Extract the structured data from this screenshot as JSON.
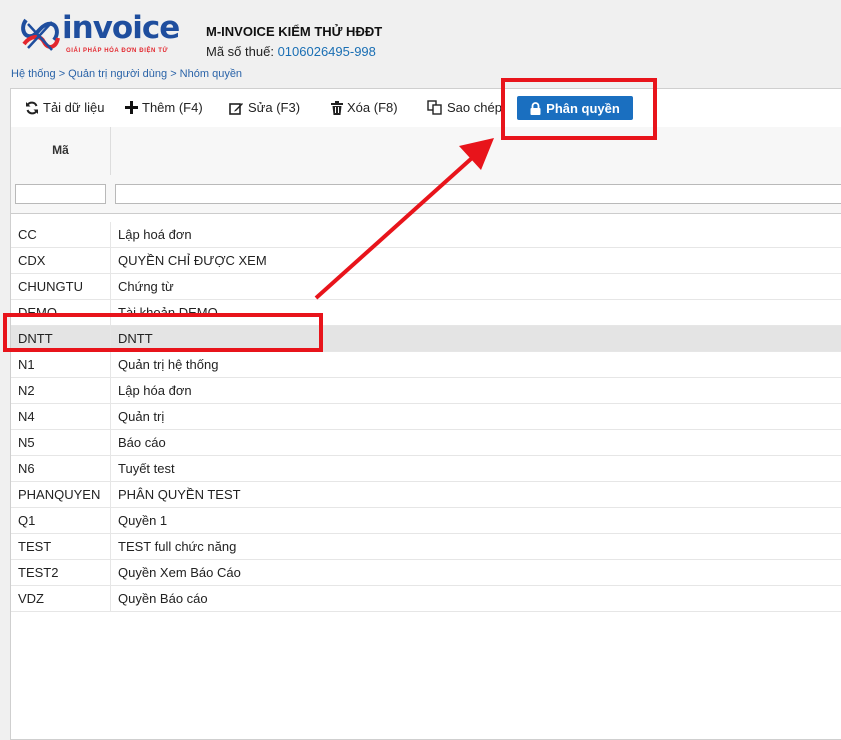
{
  "brand": {
    "logo_word": "invoice",
    "tagline": "GIẢI PHÁP HÓA ĐƠN ĐIỆN TỬ",
    "primary_color": "#1f4e9e",
    "accent_color": "#e3262d"
  },
  "header": {
    "company": "M-INVOICE KIỂM THỬ HĐĐT",
    "tax_label": "Mã số thuế:",
    "tax_value": "0106026495-998"
  },
  "breadcrumb": "Hệ thống > Quản trị người dùng > Nhóm quyền",
  "toolbar": {
    "reload": "Tải dữ liệu",
    "add": "Thêm (F4)",
    "edit": "Sửa (F3)",
    "delete": "Xóa (F8)",
    "copy": "Sao chép",
    "permission": "Phân quyền",
    "permission_color": "#1a6fc0"
  },
  "grid": {
    "col_code": "Mã",
    "rows": [
      {
        "code": "CC",
        "name": "Lập hoá đơn"
      },
      {
        "code": "CDX",
        "name": "QUYỀN CHỈ ĐƯỢC XEM"
      },
      {
        "code": "CHUNGTU",
        "name": "Chứng từ"
      },
      {
        "code": "DEMO",
        "name": "Tài khoản DEMO"
      },
      {
        "code": "DNTT",
        "name": "DNTT"
      },
      {
        "code": "N1",
        "name": "Quản trị hệ thống"
      },
      {
        "code": "N2",
        "name": "Lập hóa đơn"
      },
      {
        "code": "N4",
        "name": "Quản trị"
      },
      {
        "code": "N5",
        "name": "Báo cáo"
      },
      {
        "code": "N6",
        "name": "Tuyết test"
      },
      {
        "code": "PHANQUYEN",
        "name": "PHÂN QUYỀN TEST"
      },
      {
        "code": "Q1",
        "name": "Quyền 1"
      },
      {
        "code": "TEST",
        "name": "TEST full chức năng"
      },
      {
        "code": "TEST2",
        "name": "Quyền Xem Báo Cáo"
      },
      {
        "code": "VDZ",
        "name": "Quyền Báo cáo"
      }
    ]
  },
  "annotation_color": "#e8141b"
}
